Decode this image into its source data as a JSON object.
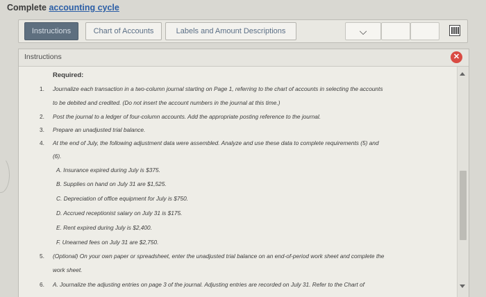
{
  "page": {
    "title_strong": "Complete ",
    "title_link": "accounting cycle"
  },
  "tabs": {
    "items": [
      {
        "label": "Instructions"
      },
      {
        "label": "Chart of Accounts"
      },
      {
        "label": "Labels and Amount Descriptions"
      }
    ]
  },
  "panel": {
    "header": "Instructions",
    "required": "Required:",
    "items": [
      {
        "num": "1.",
        "text": "Journalize each transaction in a two-column journal starting on Page 1, referring to the chart of accounts in selecting the accounts"
      },
      {
        "num": "",
        "text": "to be debited and credited. (Do not insert the account numbers in the journal at this time.)"
      },
      {
        "num": "2.",
        "text": "Post the journal to a ledger of four-column accounts. Add the appropriate posting reference to the journal."
      },
      {
        "num": "3.",
        "text": "Prepare an unadjusted trial balance."
      },
      {
        "num": "4.",
        "text": "At the end of July, the following adjustment data were assembled. Analyze and use these data to complete requirements (5) and"
      },
      {
        "num": "",
        "text": "(6)."
      }
    ],
    "adjustments": [
      "A.  Insurance expired during July is $375.",
      "B.  Supplies on hand on July 31 are $1,525.",
      "C.  Depreciation of office equipment for July is $750.",
      "D.  Accrued receptionist salary on July 31 is $175.",
      "E.  Rent expired during July is $2,400.",
      "F.  Unearned fees on July 31 are $2,750."
    ],
    "tail": [
      {
        "num": "5.",
        "text": "(Optional) On your own paper or spreadsheet, enter the unadjusted trial balance on an end-of-period work sheet and complete the"
      },
      {
        "num": "",
        "text": "work sheet."
      },
      {
        "num": "6.",
        "text": "A.  Journalize the adjusting entries on page 3 of the journal. Adjusting entries are recorded on July 31. Refer to the Chart of"
      }
    ]
  },
  "icons": {
    "dropdown": "chevron-down-icon",
    "close": "close-icon",
    "calculator": "calculator-icon"
  },
  "colors": {
    "active_tab": "#5e6f7f",
    "close_button": "#d94b43",
    "title_link": "#2b5ea6"
  }
}
